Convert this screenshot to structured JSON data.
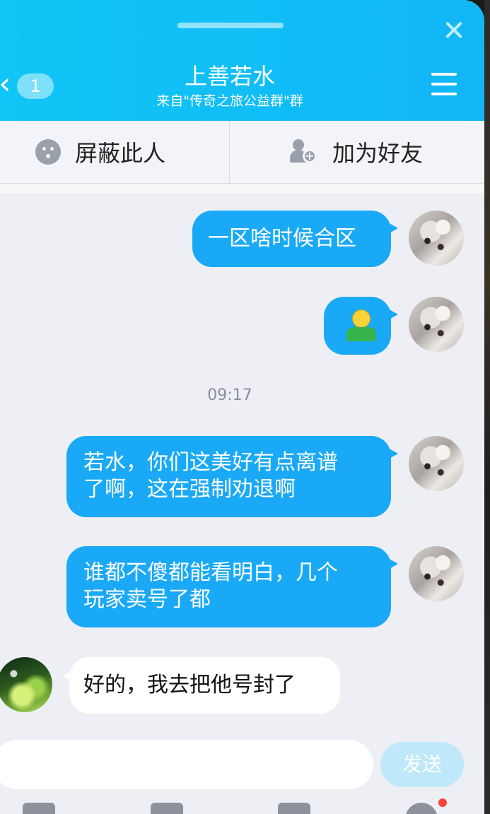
{
  "header": {
    "title": "上善若水",
    "subtitle": "来自\"传奇之旅公益群\"群",
    "back_badge": "1",
    "close_icon": "close-icon",
    "menu_icon": "hamburger-menu-icon"
  },
  "actions": {
    "block_label": "屏蔽此人",
    "add_friend_label": "加为好友"
  },
  "messages": [
    {
      "sender": "me",
      "text": "一区啥时候合区"
    },
    {
      "sender": "me",
      "type": "emoji",
      "icon": "person-emoji-icon"
    },
    {
      "type": "timestamp",
      "text": "09:17"
    },
    {
      "sender": "me",
      "lines": [
        "若水，你们这美好有点离谱",
        "了啊，这在强制劝退啊"
      ]
    },
    {
      "sender": "me",
      "lines": [
        "谁都不傻都能看明白，几个",
        "玩家卖号了都"
      ]
    },
    {
      "sender": "them",
      "text": "好的，我去把他号封了"
    }
  ],
  "composer": {
    "input_value": "",
    "send_label": "发送"
  },
  "colors": {
    "header": "#12b6f5",
    "bubble_me": "#1aa9f6",
    "send_disabled": "#bfe9fb"
  }
}
